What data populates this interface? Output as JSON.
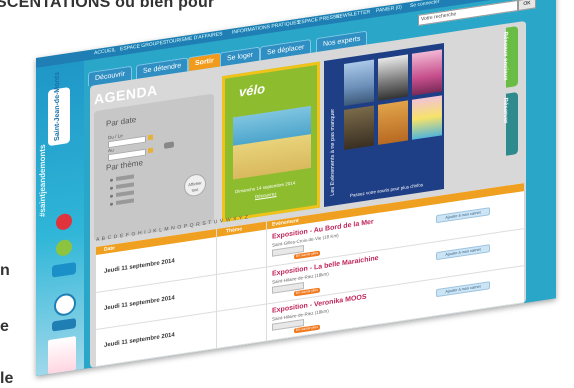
{
  "headline": "SCENTATIONS où bien pour",
  "bg_words": [
    "n",
    "e",
    "le"
  ],
  "topbar": {
    "items": [
      "ACCUEIL",
      "ESPACE GROUPES",
      "TOURISME D'AFFAIRES",
      "INFORMATIONS PRATIQUES",
      "ESPACE PRESSE"
    ],
    "newsletter": "NEWSLETTER",
    "cart": "PANIER (0)",
    "account": "Se connecter"
  },
  "sidebar": {
    "hashtag": "#saintjeandemonts",
    "logo": "Saint-Jean-de-Monts"
  },
  "nav": {
    "tabs": [
      "Découvrir",
      "Se détendre",
      "Sortir",
      "Se loger",
      "Se déplacer",
      "Nos experts"
    ],
    "active": "Sortir"
  },
  "search": {
    "placeholder": "Votre recherche",
    "button": "OK"
  },
  "agenda": {
    "title": "AGENDA",
    "par_date": "Par date",
    "du": "Du / Le",
    "au": "Au",
    "date_placeholder": "JJ/MM/AAAA",
    "ok": "OK",
    "par_theme": "Par thème",
    "themes": [
      "Enfants",
      "Sports",
      "Culture",
      "Fêtes"
    ],
    "reset": "Afficher tout"
  },
  "promo": {
    "title": "vélo",
    "caption": "Dimanche 14 septembre 2014",
    "link": "Découvrez"
  },
  "events": {
    "vertical": "Les Evènements à ne pas manquer",
    "caption": "Passez votre souris pour plus d'infos"
  },
  "side_tabs": [
    "Réseaux sociaux",
    "Réserver"
  ],
  "list": {
    "alphabet": "A B C D E F G H I J K L M N O P Q R S T U V W X Y Z",
    "headers": [
      "Date",
      "Thème",
      "Evènement"
    ],
    "rows": [
      {
        "date": "Jeudi 11 septembre 2014",
        "title": "Exposition - Au Bord de la Mer",
        "place": "Saint-Gilles-Croix-de-Vie (18 Km)",
        "more": "En savoir plus",
        "add": "Ajouter à mon carnet"
      },
      {
        "date": "Jeudi 11 septembre 2014",
        "title": "Exposition - La belle Maraichine",
        "place": "Saint-Hilaire-de-Riez (18km)",
        "more": "En savoir plus",
        "add": "Ajouter à mon carnet"
      },
      {
        "date": "Jeudi 11 septembre 2014",
        "title": "Exposition - Veronika MOOS",
        "place": "Saint-Hilaire-de-Riez (18km)",
        "more": "En savoir plus",
        "add": "Ajouter à mon carnet"
      }
    ]
  },
  "colors": {
    "accent": "#f29a1c",
    "brand": "#2aa6c9",
    "event_title": "#c0245a"
  }
}
